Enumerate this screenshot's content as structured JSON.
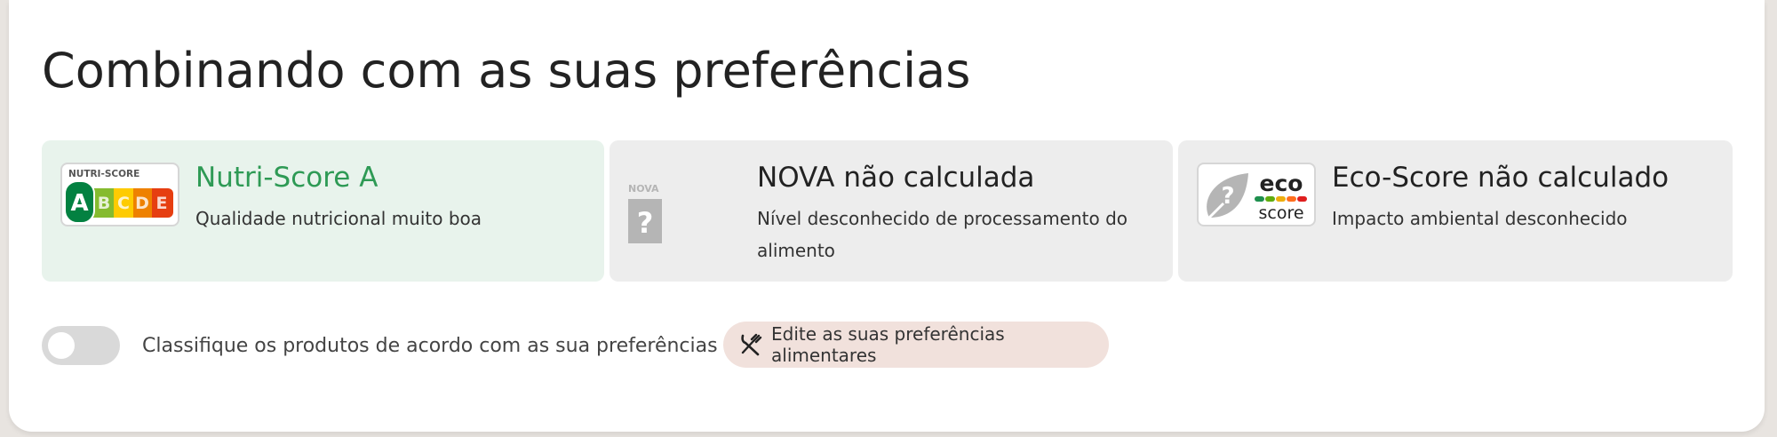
{
  "section": {
    "title": "Combinando com as suas preferências"
  },
  "cards": {
    "nutriscore": {
      "badge_label": "NUTRI-SCORE",
      "grades": [
        "A",
        "B",
        "C",
        "D",
        "E"
      ],
      "grade_colors": [
        "#038141",
        "#85bb2f",
        "#fecb02",
        "#ee8100",
        "#e63e11"
      ],
      "title": "Nutri-Score A",
      "description": "Qualidade nutricional muito boa",
      "title_color": "#2e9a55"
    },
    "nova": {
      "badge_label": "NOVA",
      "badge_symbol": "?",
      "title": "NOVA não calculada",
      "description": "Nível desconhecido de processamento do alimento"
    },
    "ecoscore": {
      "badge_top": "eco",
      "badge_bottom": "score",
      "badge_symbol": "?",
      "title": "Eco-Score não calculado",
      "description": "Impacto ambiental desconhecido"
    }
  },
  "sort_toggle": {
    "label": "Classifique os produtos de acordo com as sua preferências",
    "on": false
  },
  "preferences_button": {
    "label": "Edite as suas preferências alimentares",
    "icon": "fork-knife-icon"
  }
}
